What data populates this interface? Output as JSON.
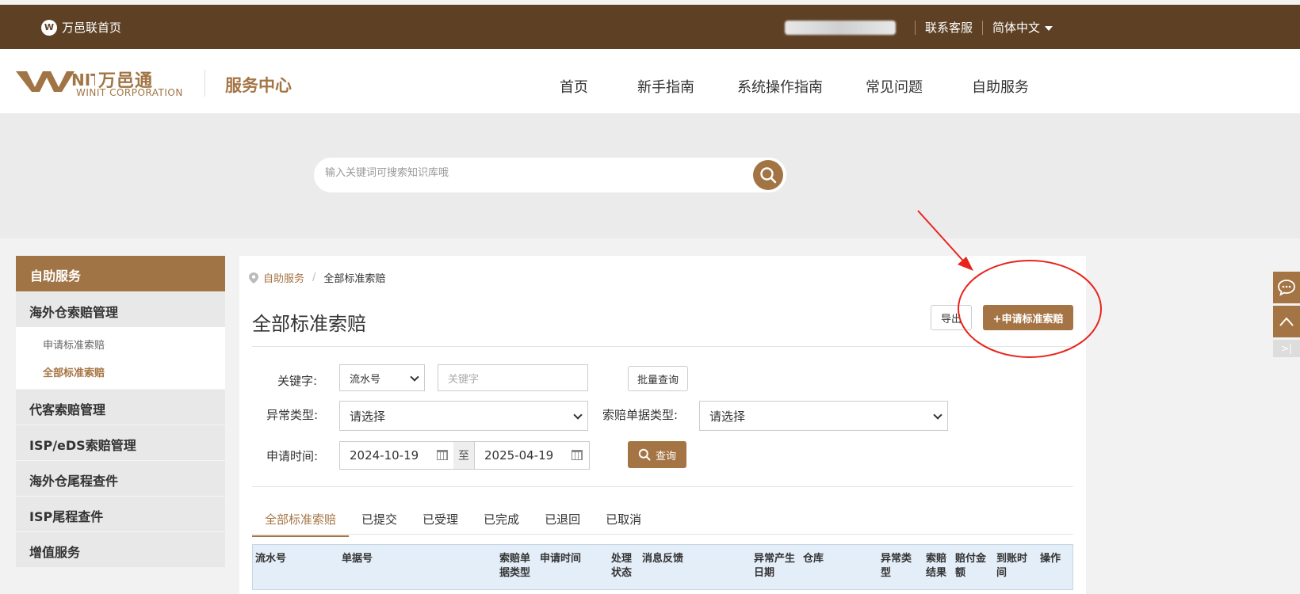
{
  "topbar": {
    "home_label": "万邑联首页",
    "contact_label": "联系客服",
    "language_label": "简体中文"
  },
  "header": {
    "brand_cn": "万邑通",
    "brand_en": "WINIT CORPORATION",
    "service_center": "服务中心",
    "nav": [
      "首页",
      "新手指南",
      "系统操作指南",
      "常见问题",
      "自助服务"
    ]
  },
  "search": {
    "placeholder": "输入关键词可搜索知识库哦"
  },
  "sidebar": {
    "title": "自助服务",
    "groups": [
      "海外仓索赔管理",
      "代客索赔管理",
      "ISP/eDS索赔管理",
      "海外仓尾程查件",
      "ISP尾程查件",
      "增值服务"
    ],
    "sub_items": [
      "申请标准索赔",
      "全部标准索赔"
    ]
  },
  "breadcrumb": {
    "parent": "自助服务",
    "current": "全部标准索赔"
  },
  "page": {
    "title": "全部标准索赔",
    "export_label": "导出",
    "apply_label": "+申请标准索赔"
  },
  "filters": {
    "keyword_label": "关键字:",
    "keyword_type": "流水号",
    "keyword_placeholder": "关键字",
    "batch_label": "批量查询",
    "exception_label": "异常类型:",
    "exception_value": "请选择",
    "doc_type_label": "索赔单据类型:",
    "doc_type_value": "请选择",
    "time_label": "申请时间:",
    "date_from": "2024-10-19",
    "to_label": "至",
    "date_to": "2025-04-19",
    "query_label": "查询"
  },
  "tabs": [
    "全部标准索赔",
    "已提交",
    "已受理",
    "已完成",
    "已退回",
    "已取消"
  ],
  "table": {
    "columns": [
      "流水号",
      "单据号",
      "索赔单\n据类型",
      "申请时间",
      "处理\n状态",
      "消息反馈",
      "异常产生\n日期",
      "仓库",
      "异常类\n型",
      "索赔\n结果",
      "赔付金\n额",
      "到账时\n间",
      "操作"
    ]
  },
  "colors": {
    "brown_dark": "#5e4124",
    "brown_accent": "#a57444",
    "annotation_red": "#e8241c"
  }
}
